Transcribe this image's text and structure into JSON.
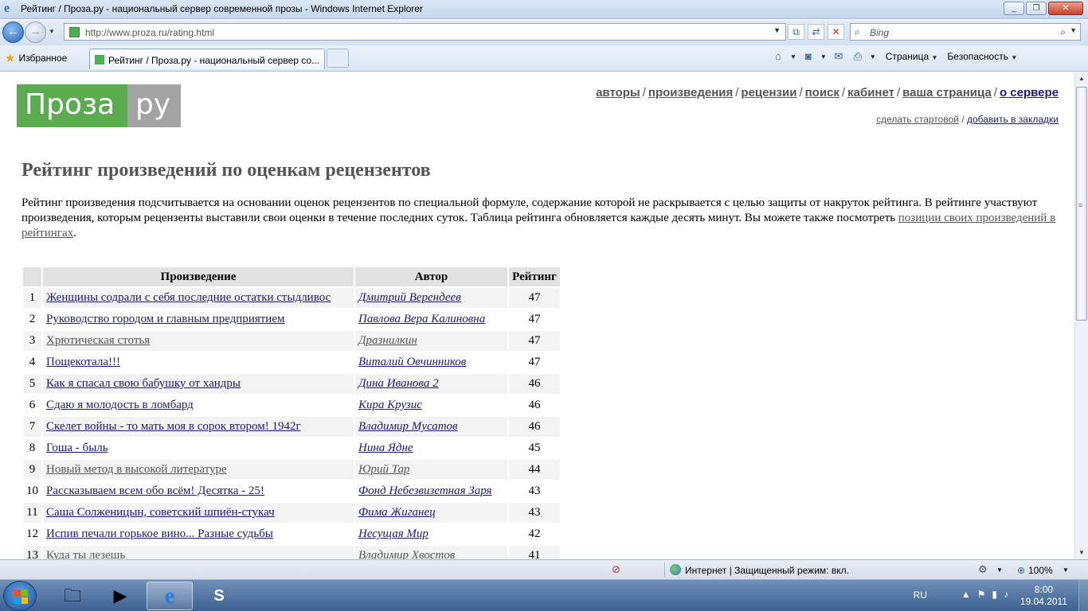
{
  "browser": {
    "window_title": "Рейтинг / Проза.ру - национальный сервер современной прозы - Windows Internet Explorer",
    "address": "http://www.proza.ru/rating.html",
    "search_placeholder": "Bing",
    "favorites_label": "Избранное",
    "tab_title": "Рейтинг / Проза.ру - национальный сервер со...",
    "cmd_page": "Страница",
    "cmd_safety": "Безопасность"
  },
  "site": {
    "logo_left": "Проза",
    "logo_right": "ру",
    "nav": [
      {
        "label": "авторы",
        "active": false
      },
      {
        "label": "произведения",
        "active": false
      },
      {
        "label": "рецензии",
        "active": false
      },
      {
        "label": "поиск",
        "active": false
      },
      {
        "label": "кабинет",
        "active": false
      },
      {
        "label": "ваша страница",
        "active": false
      },
      {
        "label": "о сервере",
        "active": true
      }
    ],
    "sublink_start": "сделать стартовой",
    "sublink_sep": "/",
    "sublink_bookmark": "добавить в закладки"
  },
  "page": {
    "title": "Рейтинг произведений по оценкам рецензентов",
    "intro_text": "Рейтинг произведения подсчитывается на основании оценок рецензентов по специальной формуле, содержание которой не раскрывается с целью защиты от накруток рейтинга. В рейтинге участвуют произведения, которым рецензенты выставили свои оценки в течение последних суток. Таблица рейтинга обновляется каждые десять минут. Вы можете также посмотреть ",
    "intro_link": "позиции своих произведений в рейтингах",
    "intro_end": "."
  },
  "table": {
    "headers": {
      "num": "",
      "work": "Произведение",
      "author": "Автор",
      "rating": "Рейтинг"
    },
    "rows": [
      {
        "n": "1",
        "work": "Женщины содрали с себя последние остатки стыдливос",
        "author": "Дмитрий Верендеев",
        "rating": "47",
        "visited": false
      },
      {
        "n": "2",
        "work": "Руководство городом и главным предприятием",
        "author": "Павлова Вера Калиновна",
        "rating": "47",
        "visited": false
      },
      {
        "n": "3",
        "work": "Хрютическая стотья",
        "author": "Дразнилкин",
        "rating": "47",
        "visited": true
      },
      {
        "n": "4",
        "work": "Пощекотала!!!",
        "author": "Виталий Овчинников",
        "rating": "47",
        "visited": false
      },
      {
        "n": "5",
        "work": "Как я спасал свою бабушку от хандры",
        "author": "Дина Иванова 2",
        "rating": "46",
        "visited": false
      },
      {
        "n": "6",
        "work": "Сдаю я молодость в ломбард",
        "author": "Кира Крузис",
        "rating": "46",
        "visited": false
      },
      {
        "n": "7",
        "work": "Скелет войны - то мать моя в сорок втором! 1942г",
        "author": "Владимир Мусатов",
        "rating": "46",
        "visited": false
      },
      {
        "n": "8",
        "work": "Гоша - быль",
        "author": "Нина Ядне",
        "rating": "45",
        "visited": false
      },
      {
        "n": "9",
        "work": "Новый метод в высокой литературе",
        "author": "Юрий Тар",
        "rating": "44",
        "visited": true
      },
      {
        "n": "10",
        "work": "Рассказываем всем обо всём! Десятка - 25!",
        "author": "Фонд Небезвизетная Заря",
        "rating": "43",
        "visited": false
      },
      {
        "n": "11",
        "work": "Саша Солженицын, советский шпиён-стукач",
        "author": "Фима Жиганец",
        "rating": "43",
        "visited": false
      },
      {
        "n": "12",
        "work": "Испив печали горькое вино... Разные судьбы",
        "author": "Несущая Мир",
        "rating": "42",
        "visited": false
      },
      {
        "n": "13",
        "work": "Куда ты лезешь",
        "author": "Владимир Хвостов",
        "rating": "41",
        "visited": true
      }
    ]
  },
  "statusbar": {
    "zone_text": "Интернет | Защищенный режим: вкл.",
    "zoom": "100%"
  },
  "taskbar": {
    "lang": "RU",
    "time": "8:00",
    "date": "19.04.2011"
  }
}
